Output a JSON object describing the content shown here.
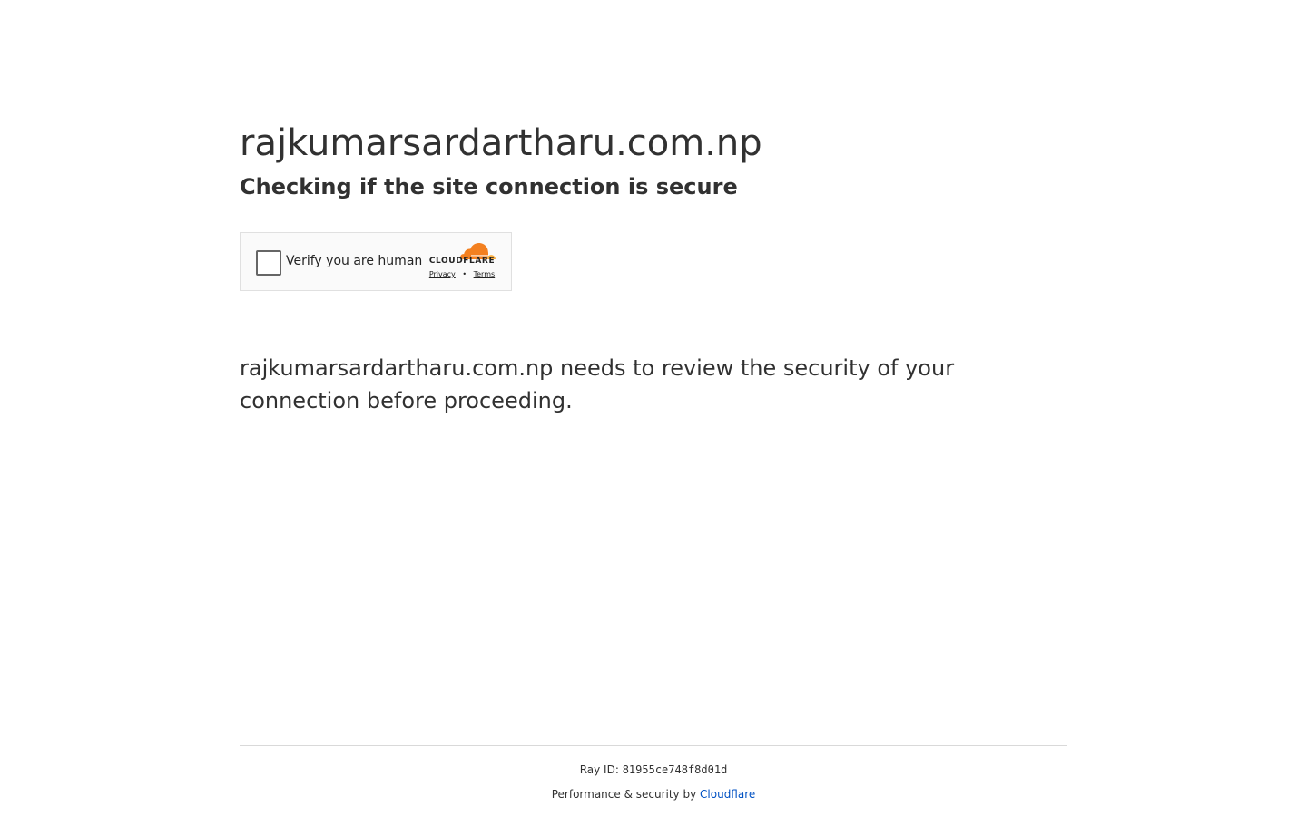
{
  "header": {
    "site_title": "rajkumarsardartharu.com.np",
    "subtitle": "Checking if the site connection is secure"
  },
  "challenge": {
    "checkbox_label": "Verify you are human",
    "brand_wordmark": "CLOUDFLARE",
    "brand_icon": "cloudflare-cloud-icon",
    "brand_color": "#f38020",
    "privacy_link": "Privacy",
    "separator": "•",
    "terms_link": "Terms"
  },
  "body": {
    "review_message": "rajkumarsardartharu.com.np needs to review the security of your connection before proceeding."
  },
  "footer": {
    "ray_label": "Ray ID:",
    "ray_id": "81955ce748f8d01d",
    "performance_text": "Performance & security by",
    "cloudflare_link": "Cloudflare",
    "link_color": "#0051c3"
  }
}
